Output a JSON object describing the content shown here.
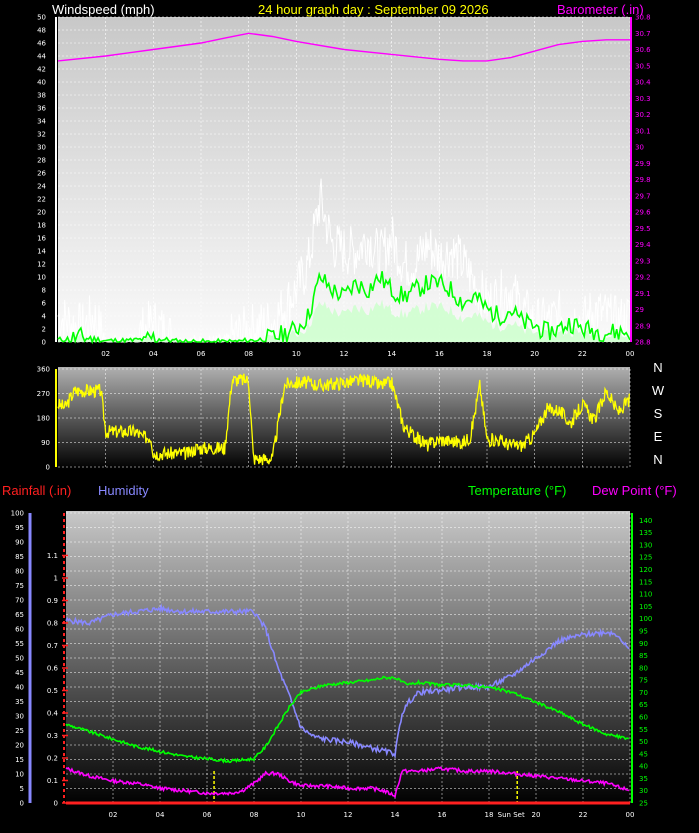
{
  "colors": {
    "windspeed_label": "#ffffff",
    "title": "#ffff00",
    "barometer": "#ff00ff",
    "gust": "#ffffff",
    "avg_wind": "#00ff00",
    "wind_fill": "#ccffcc",
    "direction": "#ffff00",
    "rainfall": "#ff2020",
    "humidity": "#8888ff",
    "temperature": "#00ff00",
    "dewpoint": "#ff00ff"
  },
  "headers": {
    "windspeed": "Windspeed (mph)",
    "title": "24 hour graph day : September 09 2026",
    "barometer": "Barometer (.in)",
    "rainfall": "Rainfall (.in)",
    "humidity": "Humidity",
    "temperature": "Temperature (°F)",
    "dewpoint": "Dew Point (°F)",
    "sunset": "Sun Set"
  },
  "compass": [
    "N",
    "W",
    "S",
    "E",
    "N"
  ],
  "chart_data": [
    {
      "type": "line",
      "name": "wind-barometer",
      "x_ticks": [
        "02",
        "04",
        "06",
        "08",
        "10",
        "12",
        "14",
        "16",
        "18",
        "20",
        "22",
        "00"
      ],
      "x_range": [
        0,
        24
      ],
      "left_axis": {
        "label": "Windspeed (mph)",
        "range": [
          0,
          50
        ],
        "ticks": [
          0,
          2,
          4,
          6,
          8,
          10,
          12,
          14,
          16,
          18,
          20,
          22,
          24,
          26,
          28,
          30,
          32,
          34,
          36,
          38,
          40,
          42,
          44,
          46,
          48,
          50
        ]
      },
      "right_axis": {
        "label": "Barometer (.in)",
        "range": [
          28.8,
          30.8
        ],
        "ticks": [
          "28.8",
          "28.9",
          "29",
          "29.1",
          "29.2",
          "29.3",
          "29.4",
          "29.5",
          "29.6",
          "29.7",
          "29.8",
          "29.9",
          "30",
          "30.1",
          "30.2",
          "30.3",
          "30.4",
          "30.5",
          "30.6",
          "30.7",
          "30.8"
        ]
      },
      "barometer": {
        "x": [
          0,
          2,
          4,
          6,
          7,
          8,
          9,
          10,
          12,
          14,
          16,
          17,
          18,
          19,
          20,
          21,
          22,
          23,
          24
        ],
        "y": [
          30.53,
          30.56,
          30.6,
          30.64,
          30.67,
          30.7,
          30.68,
          30.65,
          30.6,
          30.57,
          30.54,
          30.53,
          30.53,
          30.55,
          30.59,
          30.63,
          30.65,
          30.66,
          30.66
        ]
      },
      "gust": {
        "x": [
          0,
          0.5,
          1,
          1.5,
          2,
          3,
          4,
          5,
          6,
          7,
          8,
          9,
          10,
          10.5,
          11,
          11.5,
          12,
          12.5,
          13,
          13.5,
          14,
          14.5,
          15,
          15.5,
          16,
          16.5,
          17,
          17.5,
          18,
          18.5,
          19,
          19.5,
          20,
          20.5,
          21,
          21.5,
          22,
          22.5,
          23,
          23.5,
          24
        ],
        "y": [
          4,
          3,
          2,
          4,
          0,
          0,
          3,
          0,
          0,
          0,
          2,
          3,
          8,
          12,
          22,
          15,
          14,
          14,
          16,
          13,
          16,
          12,
          12,
          15,
          13,
          14,
          12,
          9,
          6,
          7,
          8,
          5,
          3,
          3,
          4,
          4,
          3,
          5,
          4,
          3,
          4
        ]
      },
      "avg_wind": {
        "x": [
          0,
          1,
          2,
          3,
          4,
          5,
          6,
          7,
          8,
          9,
          10,
          10.5,
          11,
          11.5,
          12,
          12.5,
          13,
          13.5,
          14,
          14.5,
          15,
          15.5,
          16,
          16.5,
          17,
          17.5,
          18,
          18.5,
          19,
          19.5,
          20,
          20.5,
          21,
          21.5,
          22,
          23,
          24
        ],
        "y": [
          0.3,
          0.8,
          0.2,
          0.2,
          0.6,
          0.1,
          0,
          0,
          0.2,
          0.6,
          2,
          4,
          10,
          8,
          7,
          9,
          8,
          10,
          8,
          7,
          8,
          9,
          9,
          8,
          6,
          7,
          5,
          4,
          5,
          3,
          2.5,
          1.5,
          2,
          3,
          2,
          1.5,
          1.5
        ]
      }
    },
    {
      "type": "line",
      "name": "wind-direction",
      "x_range": [
        0,
        24
      ],
      "y_axis": {
        "range": [
          0,
          360
        ],
        "ticks": [
          0,
          90,
          180,
          270,
          360
        ]
      },
      "direction": {
        "x": [
          0,
          0.3,
          0.7,
          1,
          1.8,
          2,
          3.3,
          3.5,
          3.9,
          4,
          5.5,
          5.8,
          7,
          7.3,
          8,
          8.2,
          9,
          9.5,
          9.8,
          10.5,
          11,
          12,
          13,
          13.5,
          14,
          14.5,
          15,
          15.5,
          16,
          17,
          17.3,
          17.7,
          18,
          18.5,
          19,
          19.5,
          20,
          20.5,
          21,
          21.5,
          22,
          22.5,
          23,
          23.5,
          24
        ],
        "y": [
          230,
          220,
          280,
          280,
          280,
          130,
          130,
          110,
          110,
          50,
          50,
          70,
          70,
          320,
          320,
          30,
          30,
          300,
          310,
          310,
          300,
          310,
          320,
          300,
          310,
          150,
          110,
          80,
          100,
          90,
          110,
          300,
          100,
          100,
          80,
          80,
          120,
          210,
          210,
          160,
          230,
          170,
          280,
          200,
          250
        ]
      }
    },
    {
      "type": "line",
      "name": "temperature-humidity",
      "x_ticks": [
        "02",
        "04",
        "06",
        "08",
        "10",
        "12",
        "14",
        "16",
        "18",
        "Sun Set",
        "20",
        "22",
        "00"
      ],
      "x_range": [
        0,
        24
      ],
      "humidity_axis": {
        "label": "Humidity",
        "range": [
          0,
          100
        ],
        "ticks": [
          0,
          5,
          10,
          15,
          20,
          25,
          30,
          35,
          40,
          45,
          50,
          55,
          60,
          65,
          70,
          75,
          80,
          85,
          90,
          95,
          100
        ]
      },
      "rain_axis": {
        "label": "Rainfall (.in)",
        "range": [
          0,
          1.2
        ],
        "ticks": [
          "0",
          "0.1",
          "0.2",
          "0.3",
          "0.4",
          "0.5",
          "0.6",
          "0.7",
          "0.8",
          "0.9",
          "1",
          "1.1"
        ]
      },
      "temp_axis": {
        "label": "Temperature (°F)",
        "range": [
          25,
          143
        ],
        "ticks": [
          25,
          30,
          35,
          40,
          45,
          50,
          55,
          60,
          65,
          70,
          75,
          80,
          85,
          90,
          95,
          100,
          105,
          110,
          115,
          120,
          125,
          130,
          135,
          140
        ]
      },
      "humidity": {
        "x": [
          0,
          1,
          2,
          3,
          4,
          5,
          6,
          7,
          8,
          8.5,
          9,
          9.5,
          10,
          10.5,
          11,
          12,
          13,
          14,
          14.3,
          14.6,
          15,
          16,
          17,
          18,
          19,
          20,
          21,
          22,
          23,
          23.5,
          24
        ],
        "y": [
          63,
          62,
          65,
          66,
          67,
          66,
          66,
          66,
          66,
          60,
          47,
          37,
          26,
          23,
          22,
          21,
          19,
          17,
          31,
          35,
          38,
          39,
          40,
          40,
          44,
          50,
          56,
          58,
          59,
          58,
          52
        ]
      },
      "temperature": {
        "x": [
          0,
          1,
          2,
          3,
          4,
          5,
          6,
          7,
          8,
          8.5,
          9,
          9.5,
          10,
          11,
          12,
          13,
          13.5,
          14,
          14.5,
          15,
          16,
          17,
          18,
          19,
          20,
          21,
          22,
          23,
          24
        ],
        "y": [
          57,
          54,
          51,
          48,
          46,
          44,
          43,
          42,
          43,
          48,
          56,
          64,
          70,
          73,
          74,
          75,
          76,
          76,
          73,
          74,
          73,
          73,
          72,
          70,
          66,
          62,
          57,
          53,
          51
        ]
      },
      "dewpoint": {
        "x": [
          0,
          1,
          2,
          3,
          4,
          5,
          6,
          7,
          7.5,
          8,
          8.5,
          9,
          9.5,
          10,
          11,
          12,
          13,
          13.5,
          14,
          14.3,
          15,
          16,
          17,
          18,
          19,
          20,
          21,
          22,
          23,
          24
        ],
        "y": [
          39,
          36,
          34,
          33,
          31,
          30,
          29,
          29,
          30,
          33,
          37,
          37,
          34,
          32,
          32,
          31,
          31,
          30,
          28,
          38,
          38,
          39,
          38,
          38,
          37,
          36,
          35,
          34,
          33,
          30
        ]
      },
      "sunset_hour": 19.2,
      "marker_hour": 6.3
    }
  ]
}
